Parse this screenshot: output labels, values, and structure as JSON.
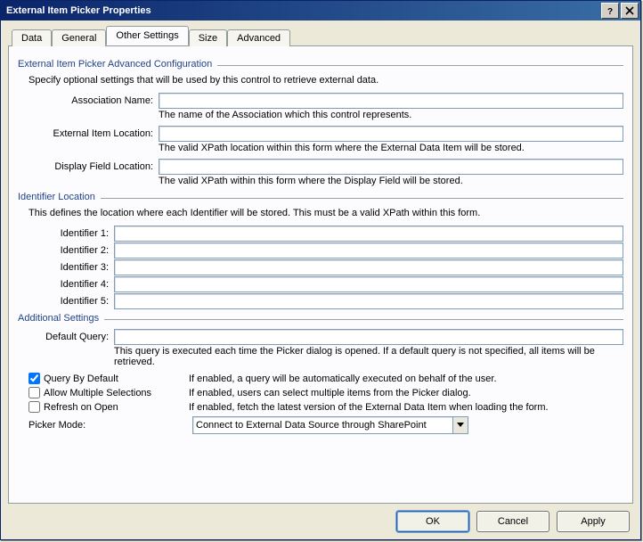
{
  "window": {
    "title": "External Item Picker Properties"
  },
  "tabs": {
    "data": "Data",
    "general": "General",
    "other_settings": "Other Settings",
    "size": "Size",
    "advanced": "Advanced"
  },
  "group_advanced": {
    "header": "External Item Picker Advanced Configuration",
    "desc": "Specify optional settings that will be used by this control to retrieve external data.",
    "assoc_label": "Association Name:",
    "assoc_value": "",
    "assoc_hint": "The name of the Association which this control represents.",
    "ext_loc_label": "External Item Location:",
    "ext_loc_value": "",
    "ext_loc_hint": "The valid XPath location within this form where the External Data Item will be stored.",
    "disp_loc_label": "Display Field Location:",
    "disp_loc_value": "",
    "disp_loc_hint": "The valid XPath within this form where the Display Field will be stored."
  },
  "group_identifier": {
    "header": "Identifier Location",
    "desc": "This defines the location where each Identifier will be stored. This must be a valid XPath within this form.",
    "rows": [
      {
        "label": "Identifier 1:",
        "value": ""
      },
      {
        "label": "Identifier 2:",
        "value": ""
      },
      {
        "label": "Identifier 3:",
        "value": ""
      },
      {
        "label": "Identifier 4:",
        "value": ""
      },
      {
        "label": "Identifier 5:",
        "value": ""
      }
    ]
  },
  "group_additional": {
    "header": "Additional Settings",
    "default_query_label": "Default Query:",
    "default_query_value": "",
    "default_query_hint": "This query is executed each time the Picker dialog is opened. If a default query is not specified, all items will be retrieved.",
    "query_by_default_label": "Query By Default",
    "query_by_default_checked": true,
    "query_by_default_desc": "If enabled, a query will be automatically executed on behalf of the user.",
    "allow_multi_label": "Allow Multiple Selections",
    "allow_multi_checked": false,
    "allow_multi_desc": "If enabled, users can select multiple items from the Picker dialog.",
    "refresh_open_label": "Refresh on Open",
    "refresh_open_checked": false,
    "refresh_open_desc": "If enabled, fetch the latest version of the External Data Item when loading the form.",
    "picker_mode_label": "Picker Mode:",
    "picker_mode_value": "Connect to External Data Source through SharePoint"
  },
  "footer": {
    "ok": "OK",
    "cancel": "Cancel",
    "apply": "Apply"
  }
}
